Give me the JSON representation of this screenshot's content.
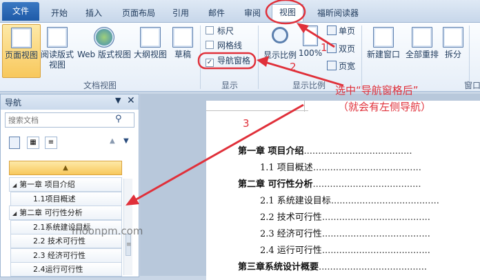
{
  "tabs": {
    "file": "文件",
    "home": "开始",
    "insert": "插入",
    "layout": "页面布局",
    "references": "引用",
    "mailings": "邮件",
    "review": "审阅",
    "view": "视图",
    "foxit": "福昕阅读器"
  },
  "ribbon": {
    "doc_views": {
      "print_layout": "页面视图",
      "reading_line1": "阅读版式",
      "reading_line2": "视图",
      "web_layout": "Web 版式视图",
      "outline": "大纲视图",
      "draft": "草稿",
      "group_label": "文档视图"
    },
    "show": {
      "ruler": "标尺",
      "gridlines": "网格线",
      "nav_pane": "导航窗格",
      "nav_pane_checked": "✓",
      "group_label": "显示"
    },
    "zoom": {
      "zoom": "显示比例",
      "hundred": "100%",
      "one_page": "单页",
      "two_pages": "双页",
      "page_width": "页宽",
      "group_label": "显示比例"
    },
    "window": {
      "new_window": "新建窗口",
      "arrange_all": "全部重排",
      "split": "拆分",
      "group_label": "窗口"
    }
  },
  "nav_pane": {
    "title": "导航",
    "search_placeholder": "搜索文档",
    "items": [
      {
        "text": "第一章 项目介绍",
        "level": 1
      },
      {
        "text": "1.1项目概述",
        "level": 2
      },
      {
        "text": "第二章 可行性分析",
        "level": 1
      },
      {
        "text": "2.1系统建设目标",
        "level": 2
      },
      {
        "text": "2.2 技术可行性",
        "level": 2
      },
      {
        "text": "2.3 经济可行性",
        "level": 2
      },
      {
        "text": "2.4运行可行性",
        "level": 2
      }
    ]
  },
  "document": {
    "toc": [
      {
        "text": "第一章 项目介绍",
        "bold": true
      },
      {
        "text": "1.1 项目概述",
        "bold": false
      },
      {
        "text": "第二章 可行性分析",
        "bold": true
      },
      {
        "text": "2.1 系统建设目标",
        "bold": false
      },
      {
        "text": "2.2 技术可行性",
        "bold": false
      },
      {
        "text": "2.3 经济可行性",
        "bold": false
      },
      {
        "text": "2.4 运行可行性",
        "bold": false
      },
      {
        "text": "第三章系统设计概要",
        "bold": true
      }
    ]
  },
  "annotations": {
    "step1": "1",
    "step2": "2",
    "step3": "3",
    "note_line1": "选中“导航窗格后”",
    "note_line2": "（就会有左侧导航）",
    "color": "#e0303a"
  },
  "watermark": "moonpm.com"
}
